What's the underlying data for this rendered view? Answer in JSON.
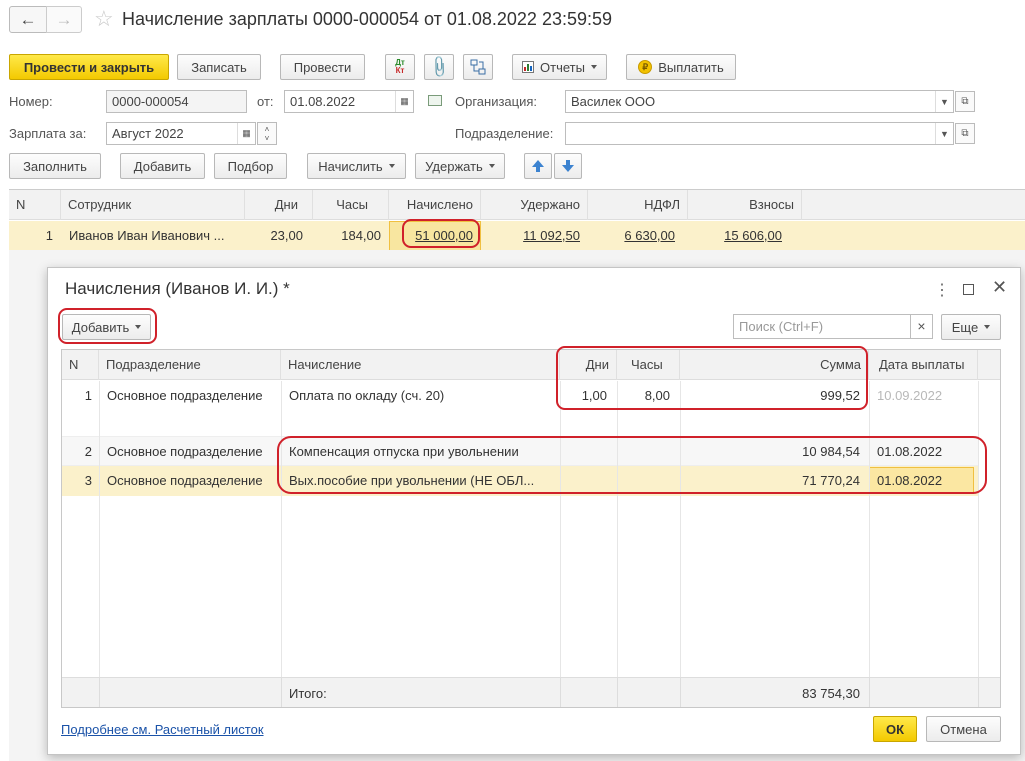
{
  "window": {
    "title": "Начисление зарплаты 0000-000054 от 01.08.2022 23:59:59"
  },
  "toolbar": {
    "post_close": "Провести и закрыть",
    "save": "Записать",
    "post": "Провести",
    "dtkt_top": "Дт",
    "dtkt_bottom": "Кт",
    "reports": "Отчеты",
    "pay": "Выплатить"
  },
  "form": {
    "number_label": "Номер:",
    "number_value": "0000-000054",
    "from_label": "от:",
    "date_value": "01.08.2022",
    "org_label": "Организация:",
    "org_value": "Василек ООО",
    "salary_label": "Зарплата за:",
    "salary_value": "Август 2022",
    "dept_label": "Подразделение:",
    "dept_value": ""
  },
  "actions": {
    "fill": "Заполнить",
    "add": "Добавить",
    "pick": "Подбор",
    "accrue": "Начислить",
    "withhold": "Удержать"
  },
  "main_table": {
    "headers": [
      "N",
      "Сотрудник",
      "Дни",
      "Часы",
      "Начислено",
      "Удержано",
      "НДФЛ",
      "Взносы"
    ],
    "row": {
      "n": "1",
      "employee": "Иванов Иван Иванович ...",
      "days": "23,00",
      "hours": "184,00",
      "accrued": "51 000,00",
      "withheld": "11 092,50",
      "ndfl": "6 630,00",
      "contrib": "15 606,00"
    }
  },
  "dialog": {
    "title": "Начисления (Иванов И. И.) *",
    "add": "Добавить",
    "search_placeholder": "Поиск (Ctrl+F)",
    "search_clear": "×",
    "more": "Еще",
    "headers": [
      "N",
      "Подразделение",
      "Начисление",
      "Дни",
      "Часы",
      "Сумма",
      "Дата выплаты"
    ],
    "rows": [
      {
        "n": "1",
        "dept": "Основное подразделение",
        "accrual": "Оплата по окладу (сч. 20)",
        "days": "1,00",
        "hours": "8,00",
        "sum": "999,52",
        "date": "10.09.2022"
      },
      {
        "n": "2",
        "dept": "Основное подразделение",
        "accrual": "Компенсация отпуска при увольнении",
        "days": "",
        "hours": "",
        "sum": "10 984,54",
        "date": "01.08.2022"
      },
      {
        "n": "3",
        "dept": "Основное подразделение",
        "accrual": "Вых.пособие при увольнении (НЕ ОБЛ...",
        "days": "",
        "hours": "",
        "sum": "71 770,24",
        "date": "01.08.2022"
      }
    ],
    "total_label": "Итого:",
    "total_value": "83 754,30",
    "footer_link": "Подробнее см. Расчетный листок",
    "ok": "ОК",
    "cancel": "Отмена"
  },
  "colors": {
    "accent_yellow": "#f7d417",
    "selected_row": "#fbf1cb",
    "highlight_red": "#d0212a",
    "link_blue": "#1a52a8"
  }
}
